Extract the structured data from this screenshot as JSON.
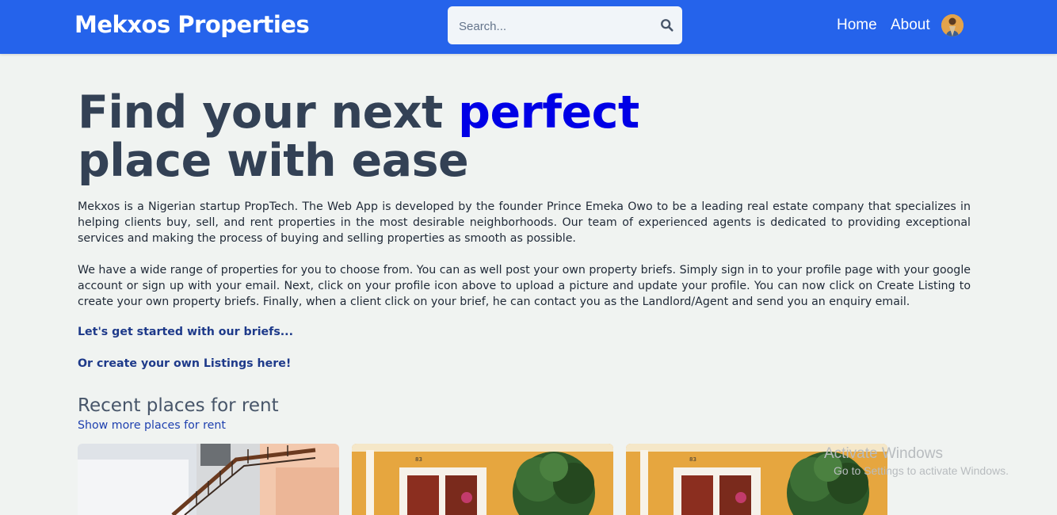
{
  "header": {
    "brand": "Mekxos Properties",
    "search_placeholder": "Search...",
    "search_icon": "search-icon",
    "nav": {
      "home": "Home",
      "about": "About"
    },
    "avatar": "profile-avatar"
  },
  "hero": {
    "title_part1": "Find your next ",
    "title_accent": "perfect",
    "title_part2": "place with ease",
    "paragraph1": "Mekxos is a Nigerian startup PropTech. The Web App is developed by the founder Prince Emeka Owo to be a leading real estate company that specializes in helping clients buy, sell, and rent properties in the most desirable neighborhoods. Our team of experienced agents is dedicated to providing exceptional services and making the process of buying and selling properties as smooth as possible.",
    "paragraph2": "We have a wide range of properties for you to choose from. You can as well post your own property briefs. Simply sign in to your profile page with your google account or sign up with your email. Next, click on your profile icon above to upload a picture and update your profile. You can now click on Create Listing to create your own property briefs. Finally, when a client click on your brief, he can contact you as the Landlord/Agent and send you an enquiry email.",
    "cta_briefs": "Let's get started with our briefs...",
    "cta_create": "Or create your own Listings here!"
  },
  "recent": {
    "title": "Recent places for rent",
    "show_more": "Show more places for rent"
  },
  "colors": {
    "header_bg": "#2563eb",
    "accent": "#0000e6",
    "link": "#1e3a8a"
  },
  "watermark": {
    "line1": "Activate Windows",
    "line2": "Go to Settings to activate Windows."
  }
}
